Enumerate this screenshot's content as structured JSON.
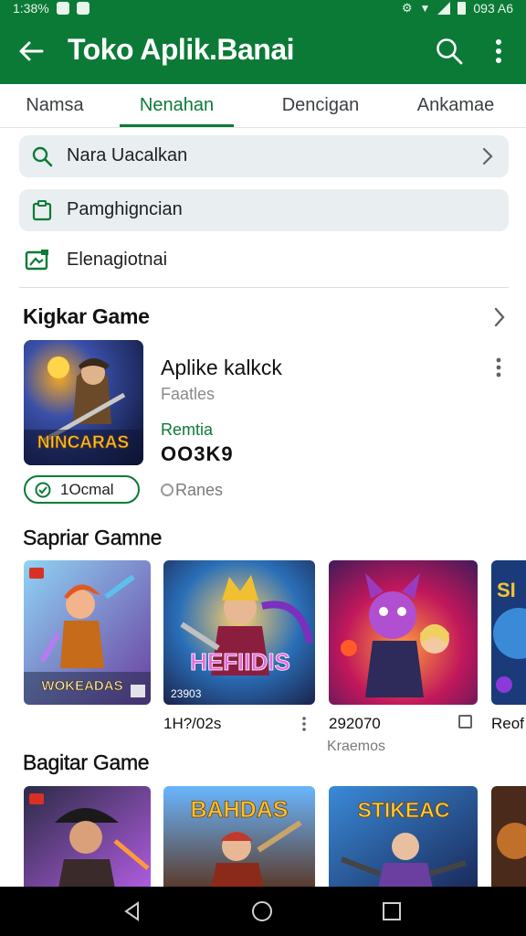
{
  "status_bar": {
    "left_text": "1:38%",
    "right_text": "093 A6"
  },
  "app_bar": {
    "title": "Toko Aplik.Banai"
  },
  "tabs": [
    {
      "label": "Namsa"
    },
    {
      "label": "Nenahan"
    },
    {
      "label": "Dencigan"
    },
    {
      "label": "Ankamae"
    }
  ],
  "active_tab": "Nenahan",
  "menu": [
    {
      "label": "Nara Uacalkan",
      "icon": "search-icon"
    },
    {
      "label": "Pamghigncian",
      "icon": "clipboard-icon"
    },
    {
      "label": "Elenagiotnai",
      "icon": "image-icon"
    }
  ],
  "sections": {
    "featured_title": "Kigkar Game",
    "second_title": "Sapriar Gamne",
    "third_title": "Bagitar Game"
  },
  "featured": {
    "name": "Aplike kalkck",
    "subtitle": "Faatles",
    "tag": "Remtia",
    "count": "OO3K9",
    "pill_label": "1Ocmal",
    "rating_label": "Ranes",
    "art_text": "NINCARAS"
  },
  "row1": [
    {
      "art": "WOKEADAS",
      "label": "",
      "sub": ""
    },
    {
      "art": "HEFIIDIS",
      "badge": "23903",
      "label": "1H?/02s",
      "sub": ""
    },
    {
      "art": "",
      "label": "292070",
      "sub": "Kraemos"
    },
    {
      "art": "SI",
      "label": "Reof",
      "sub": ""
    }
  ],
  "row2": [
    {
      "art": ""
    },
    {
      "art": "BAHDAS"
    },
    {
      "art": "STIKEAC"
    },
    {
      "art": ""
    }
  ],
  "colors": {
    "primary": "#0b7a36",
    "surface": "#e9eef0"
  }
}
